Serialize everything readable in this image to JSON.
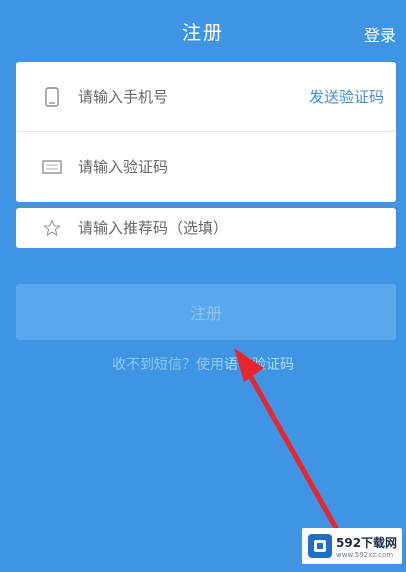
{
  "header": {
    "title": "注册",
    "login_label": "登录"
  },
  "form": {
    "phone_placeholder": "请输入手机号",
    "send_code_label": "发送验证码",
    "code_placeholder": "请输入验证码",
    "referral_placeholder": "请输入推荐码（选填）"
  },
  "register_button_label": "注册",
  "voice_tip": {
    "prefix": "收不到短信？使用",
    "link": "语音验证码"
  },
  "watermark": {
    "brand": "592下载网",
    "sub": "www.592xz.com"
  },
  "colors": {
    "background": "#3f95e4",
    "accent": "#3d8fd8",
    "arrow": "#e8262d"
  },
  "icons": [
    "phone-icon",
    "message-icon",
    "star-icon",
    "annotation-arrow"
  ]
}
